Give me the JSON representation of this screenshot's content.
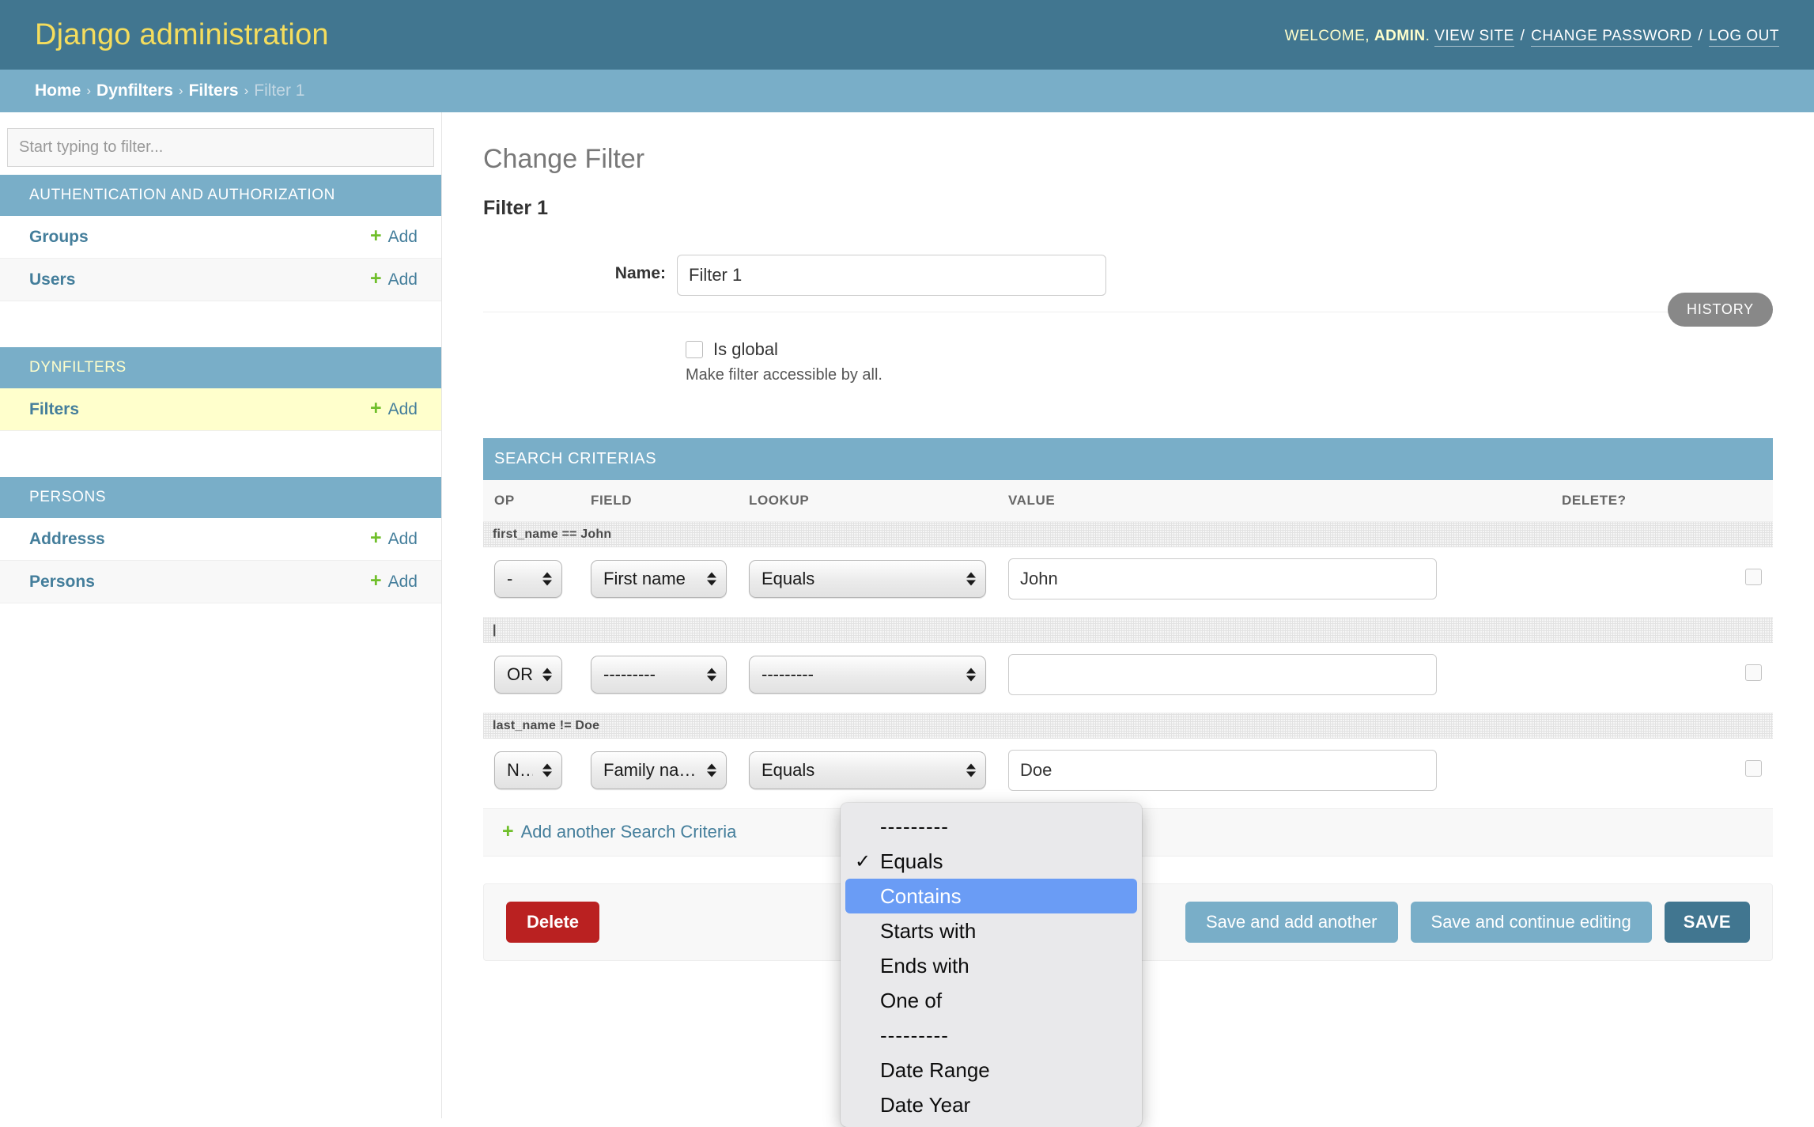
{
  "header": {
    "site_title": "Django administration",
    "welcome_prefix": "WELCOME,",
    "username": "ADMIN",
    "period": ".",
    "view_site": "VIEW SITE",
    "change_password": "CHANGE PASSWORD",
    "log_out": "LOG OUT",
    "separator": "/"
  },
  "breadcrumbs": {
    "items": [
      {
        "label": "Home",
        "current": false
      },
      {
        "label": "Dynfilters",
        "current": false
      },
      {
        "label": "Filters",
        "current": false
      },
      {
        "label": "Filter 1",
        "current": true
      }
    ],
    "separator": "›"
  },
  "sidebar": {
    "filter_placeholder": "Start typing to filter...",
    "add_label": "Add",
    "plus": "+",
    "modules": [
      {
        "caption": "AUTHENTICATION AND AUTHORIZATION",
        "current": false,
        "items": [
          {
            "label": "Groups",
            "selected": false
          },
          {
            "label": "Users",
            "selected": false
          }
        ]
      },
      {
        "caption": "DYNFILTERS",
        "current": true,
        "items": [
          {
            "label": "Filters",
            "selected": true
          }
        ]
      },
      {
        "caption": "PERSONS",
        "current": false,
        "items": [
          {
            "label": "Addresss",
            "selected": false
          },
          {
            "label": "Persons",
            "selected": false
          }
        ]
      }
    ]
  },
  "content": {
    "title": "Change Filter",
    "object_name": "Filter 1",
    "history_label": "HISTORY",
    "name_label": "Name:",
    "name_value": "Filter 1",
    "is_global_label": "Is global",
    "is_global_checked": false,
    "is_global_help": "Make filter accessible by all."
  },
  "inline": {
    "heading": "SEARCH CRITERIAS",
    "columns": {
      "op": "OP",
      "field": "FIELD",
      "lookup": "LOOKUP",
      "value": "VALUE",
      "delete": "DELETE?"
    },
    "rows": [
      {
        "label": "first_name == John",
        "op": "-",
        "field": "First name",
        "lookup": "Equals",
        "value": "John",
        "delete_checked": false
      },
      {
        "label": "|",
        "op": "OR",
        "field": "---------",
        "lookup": "---------",
        "value": "",
        "delete_checked": false
      },
      {
        "label": "last_name != Doe",
        "op": "NOT",
        "field": "Family name",
        "lookup": "Equals",
        "value": "Doe",
        "delete_checked": false
      }
    ],
    "add_another": "Add another Search Criteria",
    "add_plus": "+"
  },
  "lookup_dropdown": {
    "open": true,
    "options": [
      {
        "label": "---------",
        "checked": false,
        "highlighted": false,
        "separator": true
      },
      {
        "label": "Equals",
        "checked": true,
        "highlighted": false,
        "separator": false
      },
      {
        "label": "Contains",
        "checked": false,
        "highlighted": true,
        "separator": false
      },
      {
        "label": "Starts with",
        "checked": false,
        "highlighted": false,
        "separator": false
      },
      {
        "label": "Ends with",
        "checked": false,
        "highlighted": false,
        "separator": false
      },
      {
        "label": "One of",
        "checked": false,
        "highlighted": false,
        "separator": false
      },
      {
        "label": "---------",
        "checked": false,
        "highlighted": false,
        "separator": true
      },
      {
        "label": "Date Range",
        "checked": false,
        "highlighted": false,
        "separator": false
      },
      {
        "label": "Date Year",
        "checked": false,
        "highlighted": false,
        "separator": false
      }
    ],
    "check_glyph": "✓",
    "highlight_color": "#6a9cf5"
  },
  "submit_row": {
    "delete": "Delete",
    "save_add_another": "Save and add another",
    "save_continue": "Save and continue editing",
    "save": "SAVE"
  }
}
